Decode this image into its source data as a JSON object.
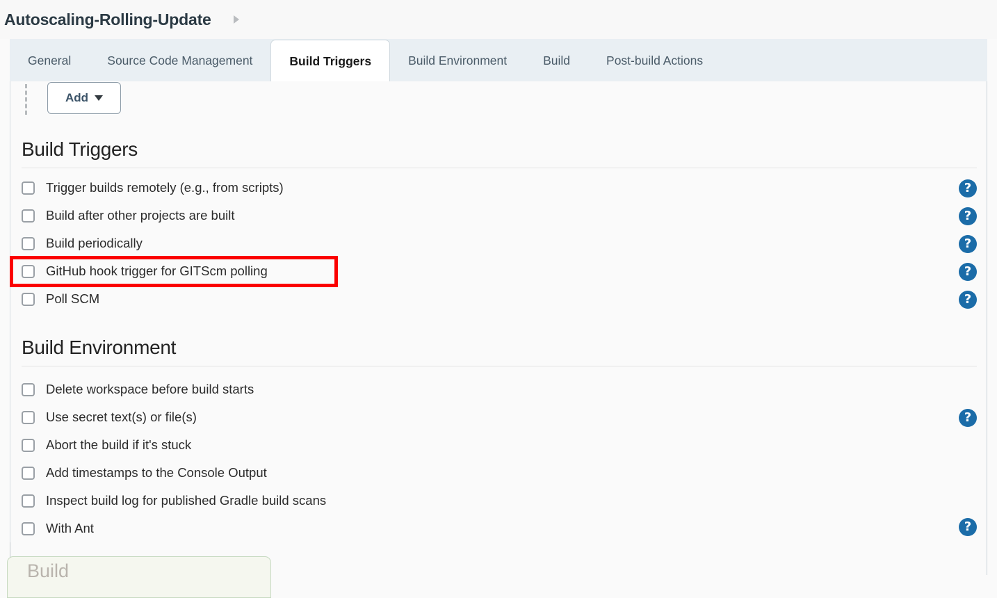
{
  "header": {
    "job_name": "Autoscaling-Rolling-Update",
    "breadcrumb_arrow_icon": "caret-right-icon"
  },
  "tabs": [
    {
      "label": "General",
      "active": false
    },
    {
      "label": "Source Code Management",
      "active": false
    },
    {
      "label": "Build Triggers",
      "active": true
    },
    {
      "label": "Build Environment",
      "active": false
    },
    {
      "label": "Build",
      "active": false
    },
    {
      "label": "Post-build Actions",
      "active": false
    }
  ],
  "toolbar": {
    "add_label": "Add",
    "add_caret_icon": "caret-down-icon"
  },
  "sections": [
    {
      "title": "Build Triggers",
      "items": [
        {
          "label": "Trigger builds remotely (e.g., from scripts)",
          "checked": false,
          "help": true
        },
        {
          "label": "Build after other projects are built",
          "checked": false,
          "help": true
        },
        {
          "label": "Build periodically",
          "checked": false,
          "help": true
        },
        {
          "label": "GitHub hook trigger for GITScm polling",
          "checked": false,
          "help": true
        },
        {
          "label": "Poll SCM",
          "checked": false,
          "help": true
        }
      ]
    },
    {
      "title": "Build Environment",
      "items": [
        {
          "label": "Delete workspace before build starts",
          "checked": false,
          "help": false
        },
        {
          "label": "Use secret text(s) or file(s)",
          "checked": false,
          "help": true
        },
        {
          "label": "Abort the build if it's stuck",
          "checked": false,
          "help": false
        },
        {
          "label": "Add timestamps to the Console Output",
          "checked": false,
          "help": false
        },
        {
          "label": "Inspect build log for published Gradle build scans",
          "checked": false,
          "help": false
        },
        {
          "label": "With Ant",
          "checked": false,
          "help": true
        }
      ]
    }
  ],
  "bottom_block": {
    "title": "Build"
  },
  "annotation": {
    "target_label": "GitHub hook trigger for GITScm polling",
    "color": "#fb0000"
  },
  "icons": {
    "help_glyph": "?"
  },
  "colors": {
    "accent_help": "#1b6ca8",
    "tabbar_bg": "#e9eff3",
    "page_bg": "#fafafa",
    "annotation": "#fb0000"
  }
}
